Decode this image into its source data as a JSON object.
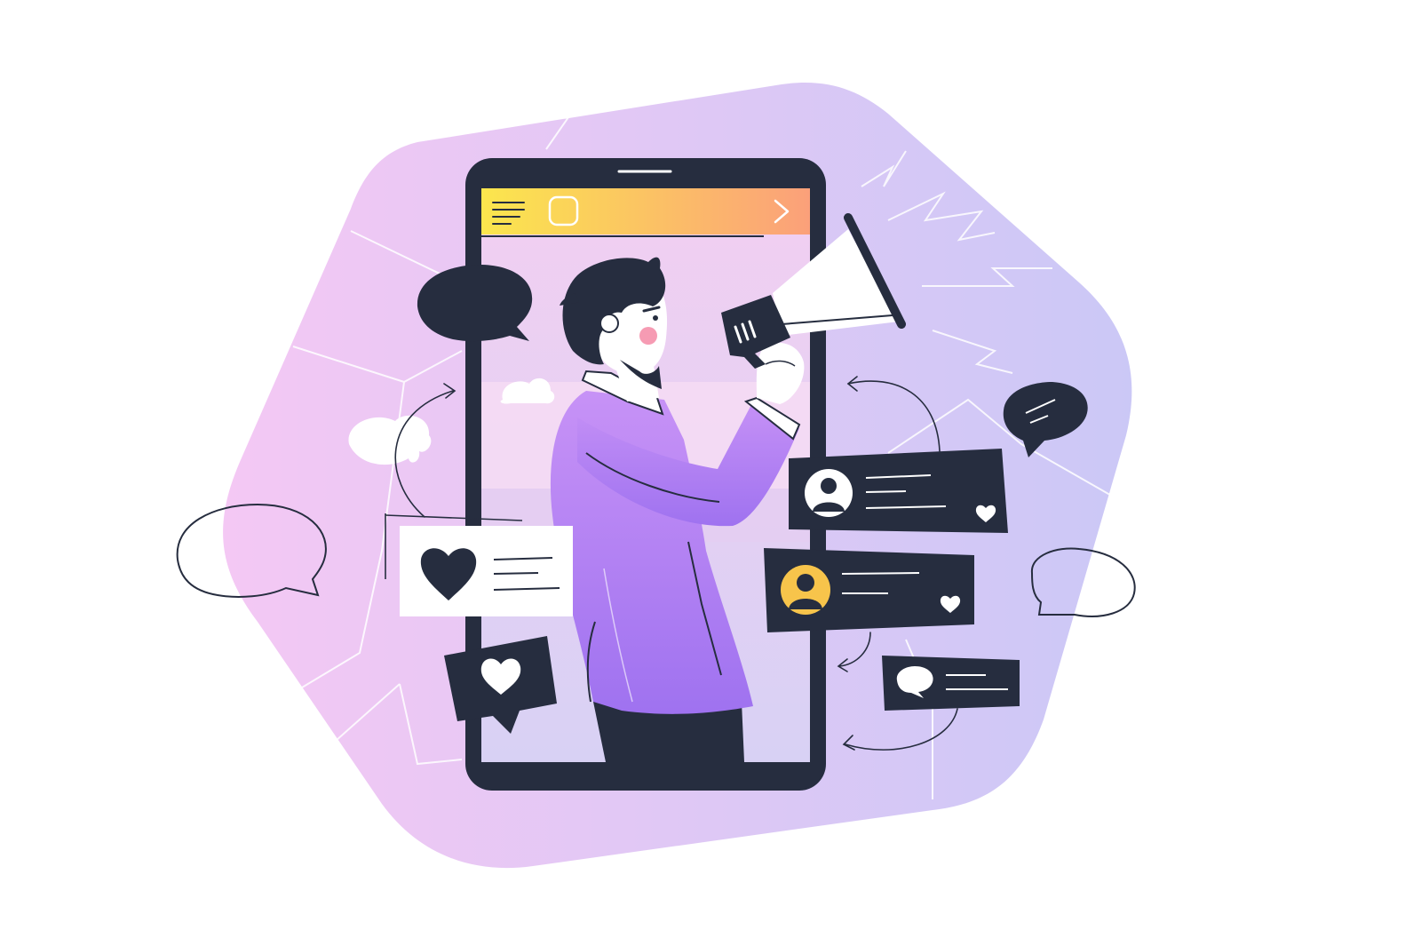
{
  "palette": {
    "dark": "#262d3f",
    "white": "#ffffff",
    "blob_left": "#f4c8f4",
    "blob_right": "#cbc8f6",
    "screen_top": "#f2cff2",
    "screen_bottom": "#d8d1f4",
    "header_left": "#fbe64d",
    "header_right": "#fba07a",
    "shirt_light": "#c792f6",
    "shirt_dark": "#9f72f0",
    "skin": "#ffffff",
    "cheek": "#f48aa6",
    "avatar_yellow": "#f7c44b"
  },
  "icons": [
    "menu-icon",
    "square-icon",
    "chevron-right-icon",
    "megaphone-icon",
    "heart-icon",
    "user-avatar-icon",
    "speech-bubble-icon",
    "curved-arrow-icon"
  ]
}
